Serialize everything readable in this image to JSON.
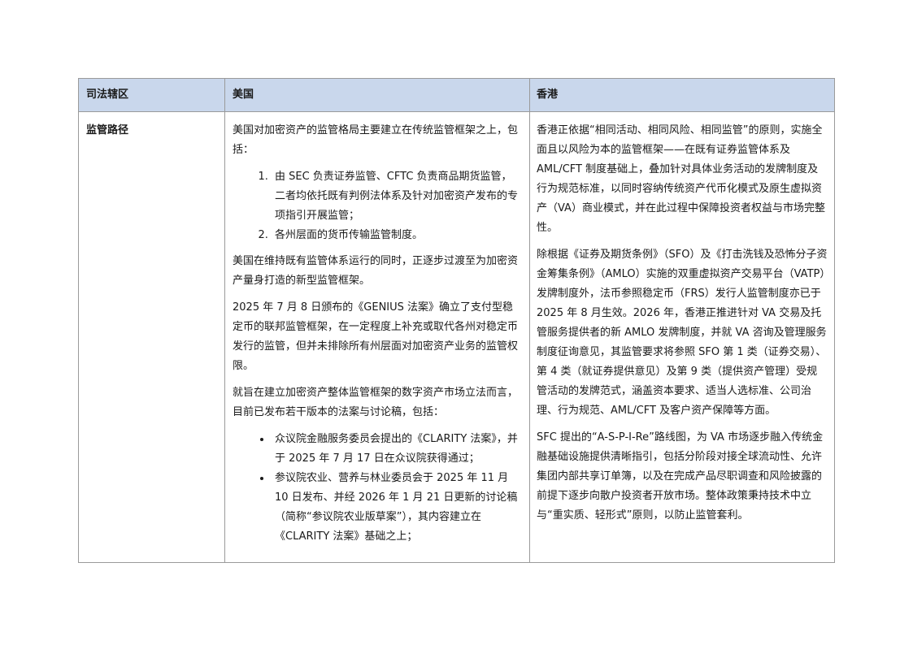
{
  "table": {
    "headers": [
      "司法辖区",
      "美国",
      "香港"
    ],
    "row_label": "监管路径",
    "us": {
      "intro": "美国对加密资产的监管格局主要建立在传统监管框架之上，包括：",
      "framework_items": [
        "由 SEC 负责证券监管、CFTC 负责商品期货监管，二者均依托既有判例法体系及针对加密资产发布的专项指引开展监管；",
        "各州层面的货币传输监管制度。"
      ],
      "transition": "美国在维持既有监管体系运行的同时，正逐步过渡至为加密资产量身打造的新型监管框架。",
      "genius": "2025 年 7 月 8 日颁布的《GENIUS 法案》确立了支付型稳定币的联邦监管框架，在一定程度上补充或取代各州对稳定币发行的监管，但并未排除所有州层面对加密资产业务的监管权限。",
      "market_intro": "就旨在建立加密资产整体监管框架的数字资产市场立法而言，目前已发布若干版本的法案与讨论稿，包括：",
      "bills": [
        "众议院金融服务委员会提出的《CLARITY 法案》，并于 2025 年 7 月 17 日在众议院获得通过；",
        "参议院农业、营养与林业委员会于 2025 年 11 月 10 日发布、并经 2026 年 1 月 21 日更新的讨论稿（简称“参议院农业版草案”），其内容建立在《CLARITY 法案》基础之上；"
      ]
    },
    "hk": {
      "p1": "香港正依据“相同活动、相同风险、相同监管”的原则，实施全面且以风险为本的监管框架——在既有证券监管体系及 AML/CFT 制度基础上，叠加针对具体业务活动的发牌制度及行为规范标准，以同时容纳传统资产代币化模式及原生虚拟资产（VA）商业模式，并在此过程中保障投资者权益与市场完整性。",
      "p2": "除根据《证券及期货条例》（SFO）及《打击洗钱及恐怖分子资金筹集条例》（AMLO）实施的双重虚拟资产交易平台（VATP）发牌制度外，法币参照稳定币（FRS）发行人监管制度亦已于 2025 年 8 月生效。2026 年，香港正推进针对 VA 交易及托管服务提供者的新 AMLO 发牌制度，并就 VA 咨询及管理服务制度征询意见，其监管要求将参照 SFO 第 1 类（证券交易）、第 4 类（就证券提供意见）及第 9 类（提供资产管理）受规管活动的发牌范式，涵盖资本要求、适当人选标准、公司治理、行为规范、AML/CFT 及客户资产保障等方面。",
      "p3": "SFC 提出的“A-S-P-I-Re”路线图，为 VA 市场逐步融入传统金融基础设施提供清晰指引，包括分阶段对接全球流动性、允许集团内部共享订单簿，以及在完成产品尽职调查和风险披露的前提下逐步向散户投资者开放市场。整体政策秉持技术中立与“重实质、轻形式”原则，以防止监管套利。"
    }
  }
}
